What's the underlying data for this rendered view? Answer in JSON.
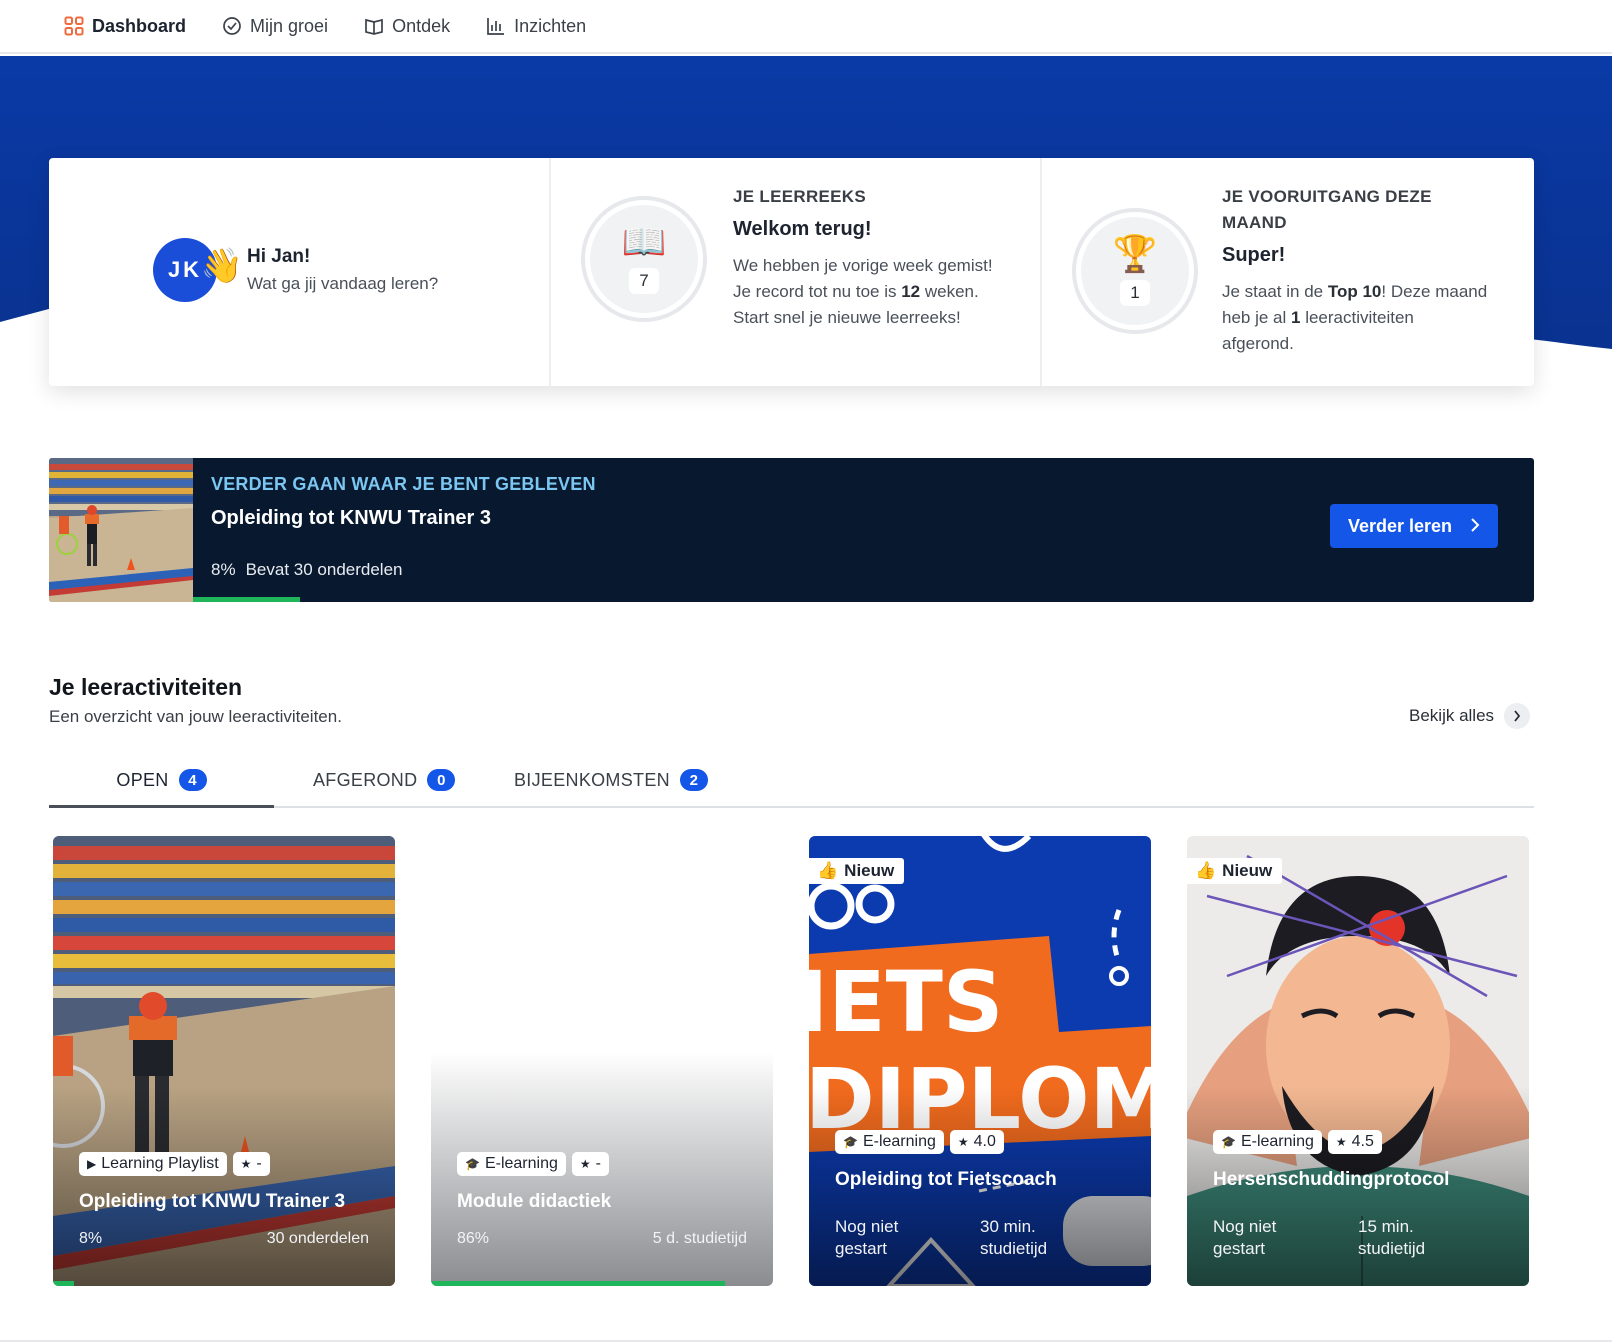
{
  "nav": {
    "items": [
      {
        "label": "Dashboard",
        "icon": "grid-icon",
        "active": true
      },
      {
        "label": "Mijn groei",
        "icon": "growth-icon",
        "active": false
      },
      {
        "label": "Ontdek",
        "icon": "book-icon",
        "active": false
      },
      {
        "label": "Inzichten",
        "icon": "chart-icon",
        "active": false
      }
    ]
  },
  "colors": {
    "hero": "#0a3aa6",
    "accent": "#1456e8",
    "success": "#1fb55a",
    "banner": "#08192f"
  },
  "greeting": {
    "initials": "JK",
    "wave": "👋",
    "title": "Hi Jan!",
    "subtitle": "Wat ga jij vandaag leren?"
  },
  "streak": {
    "label": "JE LEERREEKS",
    "emoji": "📖",
    "count": "7",
    "heading": "Welkom terug!",
    "line1": "We hebben je vorige week gemist!",
    "line2_pre": "Je record tot nu toe is ",
    "line2_bold": "12",
    "line2_post": " weken.",
    "line3": "Start snel je nieuwe leerreeks!"
  },
  "progress": {
    "label_line1": "JE VOORUITGANG DEZE",
    "label_line2": "MAAND",
    "emoji": "🏆",
    "count": "1",
    "heading": "Super!",
    "t1": "Je staat in de ",
    "t1_bold": "Top 10",
    "t2": "! Deze maand",
    "t3": "heb je al ",
    "t3_bold": "1",
    "t4": " leeractiviteiten",
    "t5": "afgerond."
  },
  "continue": {
    "kicker": "VERDER GAAN WAAR JE BENT GEBLEVEN",
    "title": "Opleiding tot KNWU Trainer 3",
    "percent": "8%",
    "parts": "Bevat 30 onderdelen",
    "progress_fraction": 0.08,
    "button": "Verder leren",
    "button_icon": "chevron-right-icon"
  },
  "activities": {
    "title": "Je leeractiviteiten",
    "subtitle": "Een overzicht van jouw leeractiviteiten.",
    "see_all": "Bekijk alles",
    "tabs": [
      {
        "label": "OPEN",
        "count": "4",
        "active": true
      },
      {
        "label": "AFGEROND",
        "count": "0",
        "active": false
      },
      {
        "label": "BIJEENKOMSTEN",
        "count": "2",
        "active": false
      }
    ],
    "cards": [
      {
        "type": "Learning Playlist",
        "type_icon": "play-icon",
        "rating": "-",
        "title": "Opleiding tot KNWU Trainer 3",
        "left": "8%",
        "right": "30 onderdelen",
        "progress_fraction": 0.06
      },
      {
        "type": "E-learning",
        "type_icon": "graduation-cap-icon",
        "rating": "-",
        "title": "Module didactiek",
        "left": "86%",
        "right": "5 d. studietijd",
        "progress_fraction": 0.86
      },
      {
        "badge": "Nieuw",
        "badge_icon": "thumbs-up-icon",
        "type": "E-learning",
        "type_icon": "graduation-cap-icon",
        "rating": "4.0",
        "title": "Opleiding tot Fietscoach",
        "status_l1": "Nog niet",
        "status_l2": "gestart",
        "time_l1": "30 min.",
        "time_l2": "studietijd"
      },
      {
        "badge": "Nieuw",
        "badge_icon": "thumbs-up-icon",
        "type": "E-learning",
        "type_icon": "graduation-cap-icon",
        "rating": "4.5",
        "title": "Hersenschuddingprotocol",
        "status_l1": "Nog niet",
        "status_l2": "gestart",
        "time_l1": "15 min.",
        "time_l2": "studietijd"
      }
    ]
  },
  "card_images": {
    "c3_line1": "IETS",
    "c3_line2": "DIPLOM"
  }
}
